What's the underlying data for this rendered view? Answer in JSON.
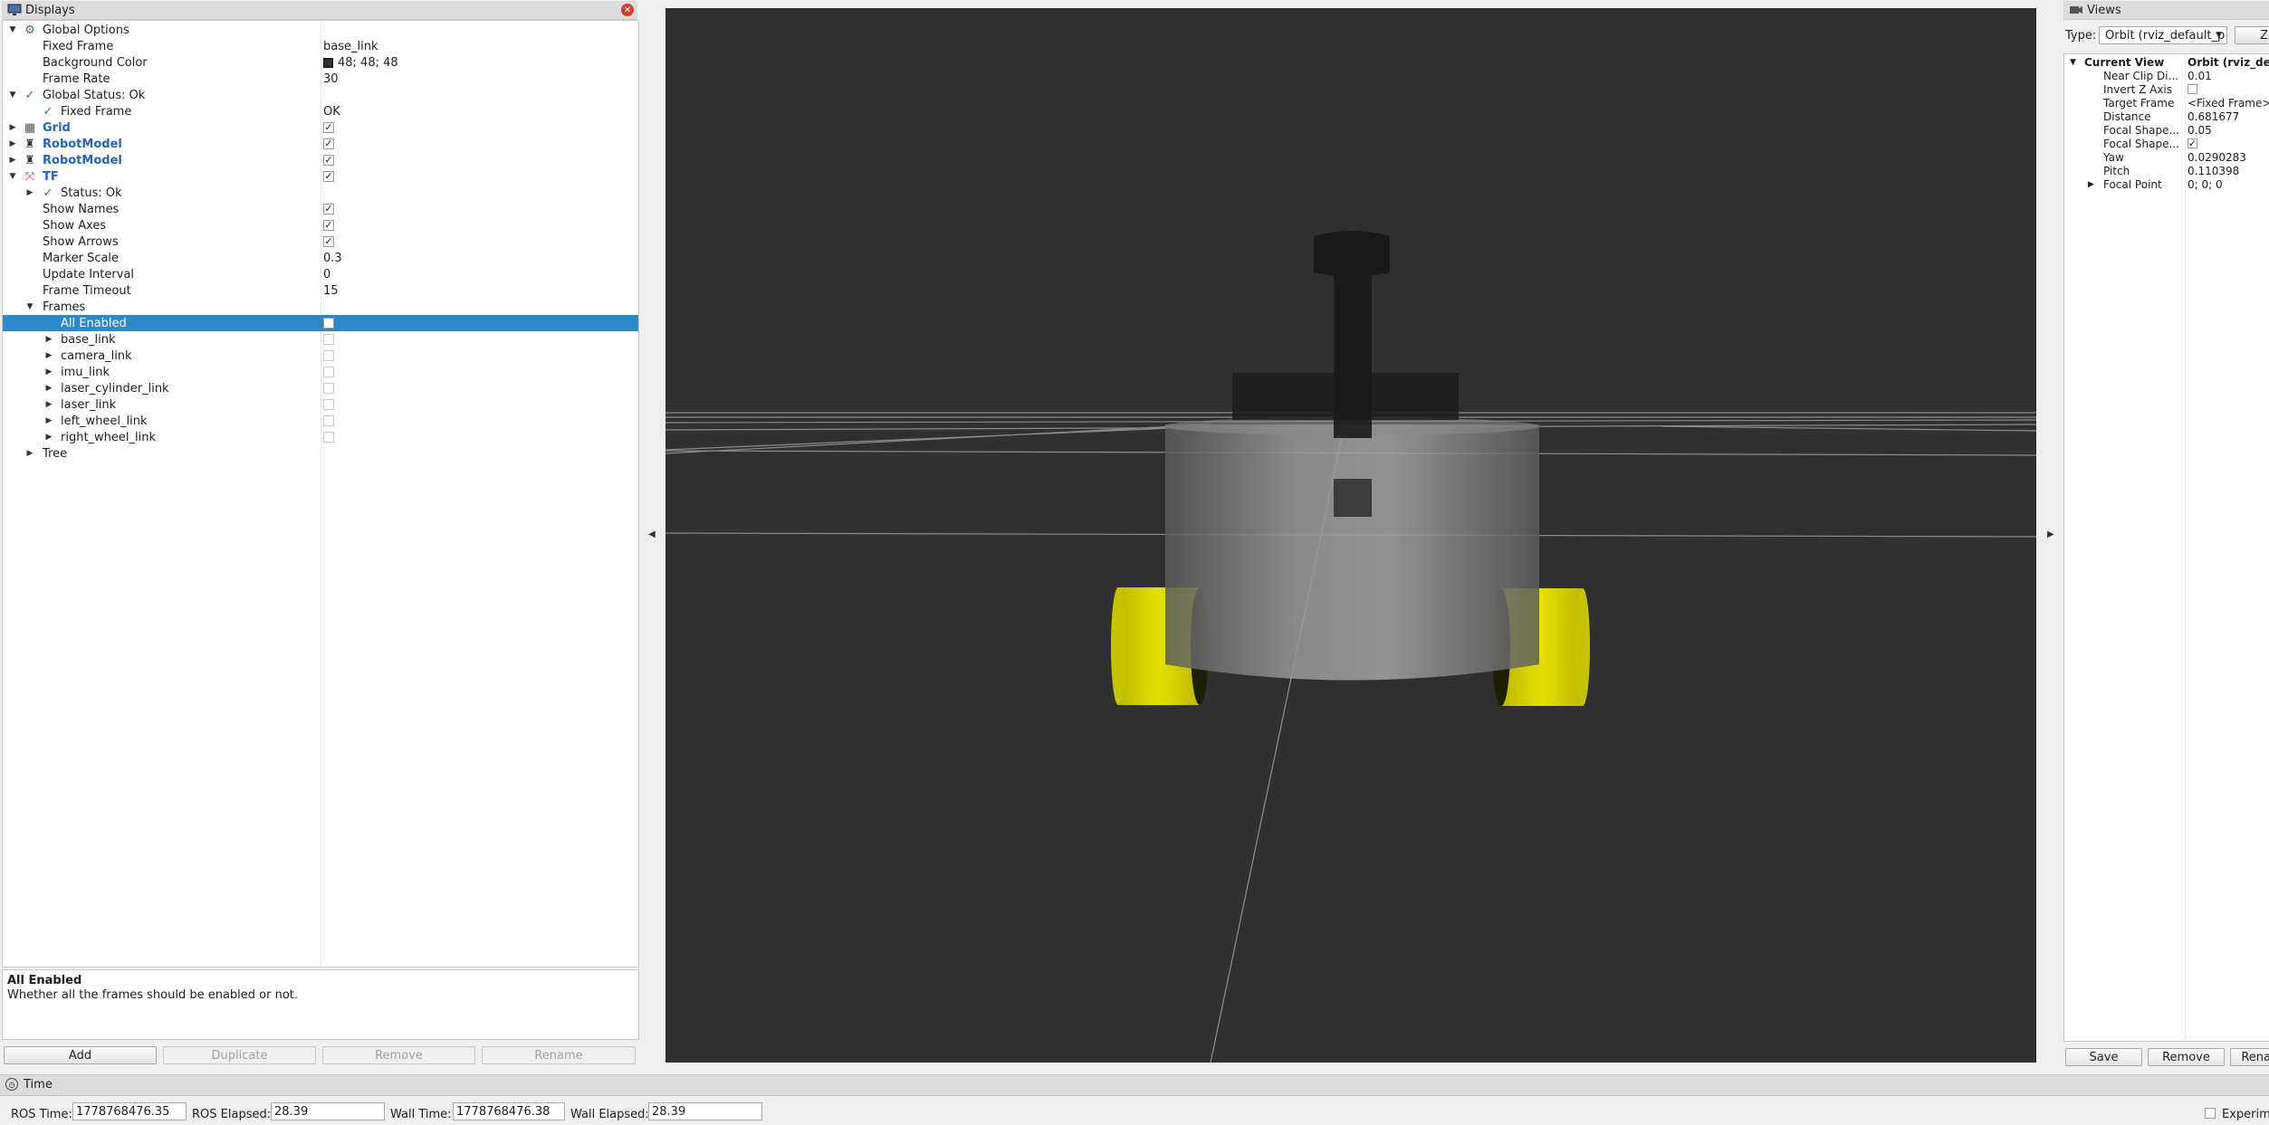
{
  "displays": {
    "title": "Displays",
    "tree": [
      {
        "label": "Global Options",
        "value": ""
      },
      {
        "label": "Fixed Frame",
        "value": "base_link"
      },
      {
        "label": "Background Color",
        "value": "48; 48; 48"
      },
      {
        "label": "Frame Rate",
        "value": "30"
      },
      {
        "label": "Global Status: Ok",
        "value": ""
      },
      {
        "label": "Fixed Frame",
        "value": "OK"
      },
      {
        "label": "Grid",
        "value": ""
      },
      {
        "label": "RobotModel",
        "value": ""
      },
      {
        "label": "RobotModel",
        "value": ""
      },
      {
        "label": "TF",
        "value": ""
      },
      {
        "label": "Status: Ok",
        "value": ""
      },
      {
        "label": "Show Names",
        "value": ""
      },
      {
        "label": "Show Axes",
        "value": ""
      },
      {
        "label": "Show Arrows",
        "value": ""
      },
      {
        "label": "Marker Scale",
        "value": "0.3"
      },
      {
        "label": "Update Interval",
        "value": "0"
      },
      {
        "label": "Frame Timeout",
        "value": "15"
      },
      {
        "label": "Frames",
        "value": ""
      },
      {
        "label": "All Enabled",
        "value": ""
      },
      {
        "label": "base_link",
        "value": ""
      },
      {
        "label": "camera_link",
        "value": ""
      },
      {
        "label": "imu_link",
        "value": ""
      },
      {
        "label": "laser_cylinder_link",
        "value": ""
      },
      {
        "label": "laser_link",
        "value": ""
      },
      {
        "label": "left_wheel_link",
        "value": ""
      },
      {
        "label": "right_wheel_link",
        "value": ""
      },
      {
        "label": "Tree",
        "value": ""
      }
    ],
    "help_title": "All Enabled",
    "help_text": "Whether all the frames should be enabled or not.",
    "buttons": {
      "add": "Add",
      "duplicate": "Duplicate",
      "remove": "Remove",
      "rename": "Rename"
    }
  },
  "views": {
    "title": "Views",
    "type_label": "Type:",
    "type_value": "Orbit (rviz_default_p",
    "zero_label": "Ze",
    "header_name": "Current View",
    "header_value": "Orbit (rviz_de",
    "props": [
      {
        "label": "Near Clip Di...",
        "value": "0.01"
      },
      {
        "label": "Invert Z Axis",
        "value": ""
      },
      {
        "label": "Target Frame",
        "value": "<Fixed Frame>"
      },
      {
        "label": "Distance",
        "value": "0.681677"
      },
      {
        "label": "Focal Shape...",
        "value": "0.05"
      },
      {
        "label": "Focal Shape...",
        "value": ""
      },
      {
        "label": "Yaw",
        "value": "0.0290283"
      },
      {
        "label": "Pitch",
        "value": "0.110398"
      },
      {
        "label": "Focal Point",
        "value": "0; 0; 0"
      }
    ],
    "buttons": {
      "save": "Save",
      "remove": "Remove",
      "rename": "Rena"
    }
  },
  "time": {
    "title": "Time",
    "ros_time_label": "ROS Time:",
    "ros_time": "1778768476.35",
    "ros_elapsed_label": "ROS Elapsed:",
    "ros_elapsed": "28.39",
    "wall_time_label": "Wall Time:",
    "wall_time": "1778768476.38",
    "wall_elapsed_label": "Wall Elapsed:",
    "wall_elapsed": "28.39",
    "experimental_label": "Experim"
  },
  "colors": {
    "viewport_bg": "#303030",
    "selection": "#2f88c9",
    "wheel": "#d9d400",
    "accent_blue": "#2463b5"
  }
}
